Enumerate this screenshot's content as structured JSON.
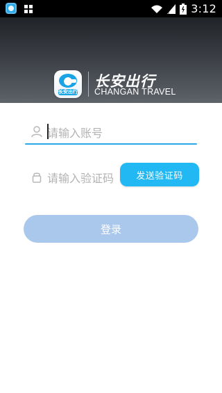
{
  "status_bar": {
    "time": "3:12",
    "icons": [
      "app-icon",
      "grid-icon",
      "wifi-icon",
      "signal-icon",
      "battery-icon"
    ]
  },
  "brand": {
    "logo_text": "长安出行",
    "name_cn": "长安出行",
    "name_en": "CHANGAN TRAVEL"
  },
  "form": {
    "account": {
      "placeholder": "请输入账号",
      "value": ""
    },
    "code": {
      "placeholder": "请输入验证码",
      "value": ""
    },
    "send_code_label": "发送验证码",
    "login_label": "登录"
  },
  "colors": {
    "header_top": "#202327",
    "header_bottom": "#5e6269",
    "accent": "#22b8f3",
    "underline": "#2aa7e6",
    "login_bg": "#a9c8ec",
    "placeholder": "#b3b3b3"
  }
}
